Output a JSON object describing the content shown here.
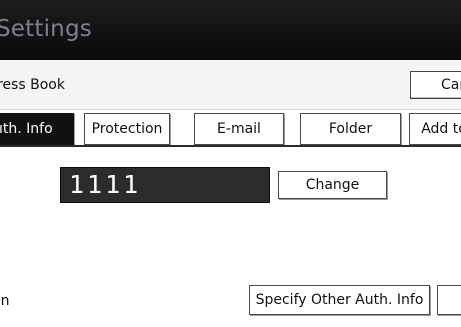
{
  "header": {
    "title": "Settings"
  },
  "subheader": {
    "label": "ress Book",
    "cancel_label": "Car"
  },
  "tabs": [
    {
      "label": "ıth. Info",
      "active": true
    },
    {
      "label": "Protection",
      "active": false
    },
    {
      "label": "E-mail",
      "active": false
    },
    {
      "label": "Folder",
      "active": false
    },
    {
      "label": "Add to",
      "active": false
    }
  ],
  "main": {
    "value": "1111",
    "change_label": "Change",
    "bottom_label": "on",
    "specify_label": "Specify Other Auth. Info"
  }
}
